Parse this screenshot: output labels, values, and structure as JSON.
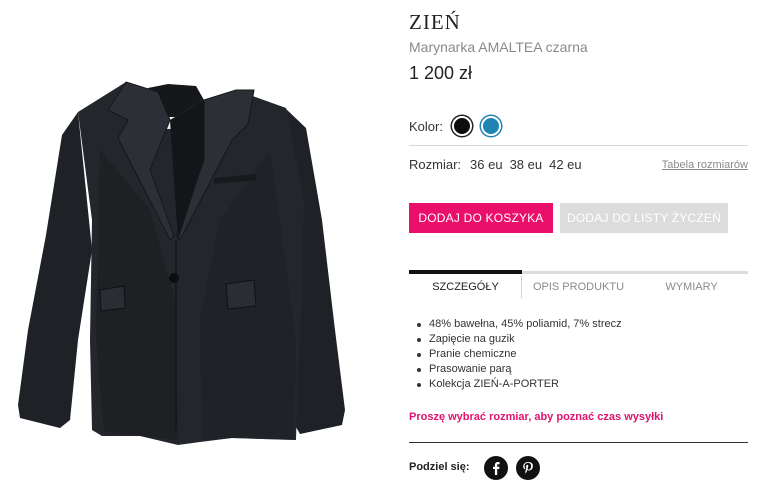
{
  "product": {
    "brand": "ZIEŃ",
    "name": "Marynarka AMALTEA czarna",
    "price": "1 200 zł",
    "image_alt": "Czarna marynarka"
  },
  "color": {
    "label": "Kolor:",
    "options": [
      {
        "name": "czarny",
        "hex": "#0d0d0d"
      },
      {
        "name": "niebieski",
        "hex": "#1d84b3"
      }
    ]
  },
  "size": {
    "label": "Rozmiar:",
    "options": [
      "36 eu",
      "38 eu",
      "42 eu"
    ],
    "table_link": "Tabela rozmiarów"
  },
  "actions": {
    "add_to_cart": "DODAJ DO KOSZYKA",
    "add_to_wishlist": "DODAJ DO LISTY ŻYCZEŃ"
  },
  "tabs": [
    {
      "label": "SZCZEGÓŁY",
      "active": true
    },
    {
      "label": "OPIS PRODUKTU",
      "active": false
    },
    {
      "label": "WYMIARY",
      "active": false
    }
  ],
  "details": [
    "48% bawełna, 45% poliamid, 7% strecz",
    "Zapięcie na guzik",
    "Pranie chemiczne",
    "Prasowanie parą",
    "Kolekcja ZIEŃ-A-PORTER"
  ],
  "shipping_notice": "Proszę wybrać rozmiar, aby poznać czas wysyłki",
  "share": {
    "label": "Podziel się:",
    "icons": [
      "facebook-icon",
      "pinterest-icon"
    ]
  },
  "colors": {
    "accent": "#ea0f6b",
    "notice": "#e0136e",
    "button_disabled": "#dcdcdc"
  }
}
